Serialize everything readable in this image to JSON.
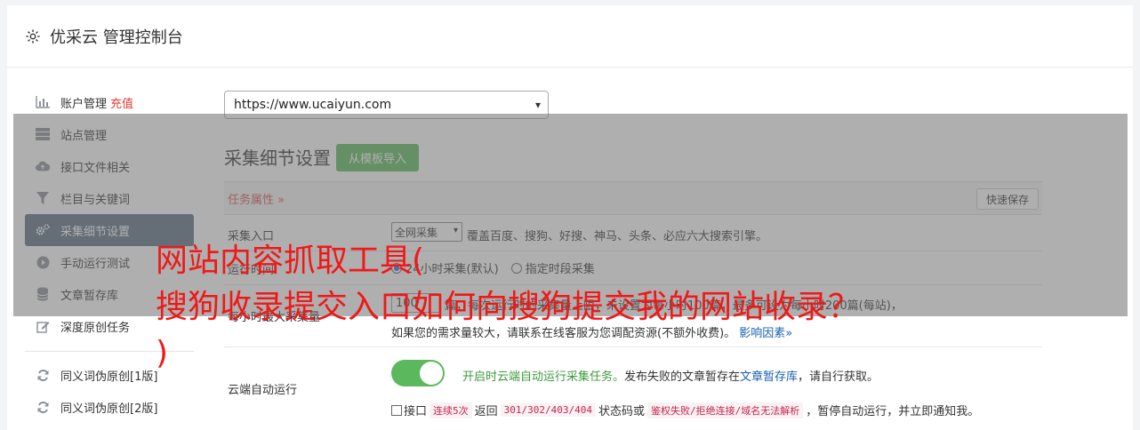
{
  "header": {
    "title": "优采云 管理控制台"
  },
  "sidebar": {
    "items": [
      {
        "label": "账户管理",
        "badge": "充值",
        "icon": "bar-chart-icon"
      },
      {
        "label": "站点管理",
        "icon": "server-icon"
      },
      {
        "label": "接口文件相关",
        "icon": "cloud-upload-icon"
      },
      {
        "label": "栏目与关键词",
        "icon": "filter-icon"
      },
      {
        "label": "采集细节设置",
        "icon": "gears-icon",
        "active": true
      },
      {
        "label": "手动运行测试",
        "icon": "play-circle-icon"
      },
      {
        "label": "文章暂存库",
        "icon": "database-icon"
      },
      {
        "label": "深度原创任务",
        "icon": "edit-icon"
      }
    ],
    "items2": [
      {
        "label": "同义词伪原创[1版]",
        "icon": "refresh-icon"
      },
      {
        "label": "同义词伪原创[2版]",
        "icon": "refresh-icon"
      }
    ]
  },
  "site_select": {
    "value": "https://www.ucaiyun.com"
  },
  "section": {
    "title": "采集细节设置",
    "import_button": "从模板导入"
  },
  "tabs": {
    "task_attr": "任务属性 »",
    "quick_save": "快速保存"
  },
  "rows": {
    "entry": {
      "label": "采集入口",
      "select_value": "全网采集",
      "desc": "覆盖百度、搜狗、好搜、神马、头条、必应六大搜索引擎。"
    },
    "run_time": {
      "label": "运行时间",
      "opt1": "24小时采集(默认)",
      "opt2": "指定时段采集"
    },
    "limit": {
      "label": "每小时最大采集量",
      "value": "100",
      "desc": "篇，每次运行时的采集量上限，未设置为每小时100篇，最多可设为每小时200篇(每站)，",
      "desc2": "如果您的需求量较大，请联系在线客服为您调配资源(不额外收费)。",
      "link": "影响因素»"
    },
    "cloud_auto": {
      "label": "云端自动运行",
      "enabled_text": "开启时云端自动运行采集任务。",
      "desc_a": "发布失败的文章暂存在",
      "link": "文章暂存库",
      "desc_b": "，请自行获取。",
      "api_prefix": "接口",
      "code1": "连续5次",
      "mid1": "返回",
      "code2": "301/302/403/404",
      "mid2": "状态码或",
      "code3": "鉴权失败/拒绝连接/域名无法解析",
      "api_suffix": "，暂停自动运行，并立即通知我。"
    }
  },
  "caption": {
    "line1": "网站内容抓取工具(",
    "line2": "搜狗收录提交入口如何向搜狗提交我的网站收录？",
    "line3": ")"
  },
  "colors": {
    "accent_green": "#5cb85c",
    "active_sidebar": "#5b6d84",
    "caption_red": "#f01818"
  }
}
